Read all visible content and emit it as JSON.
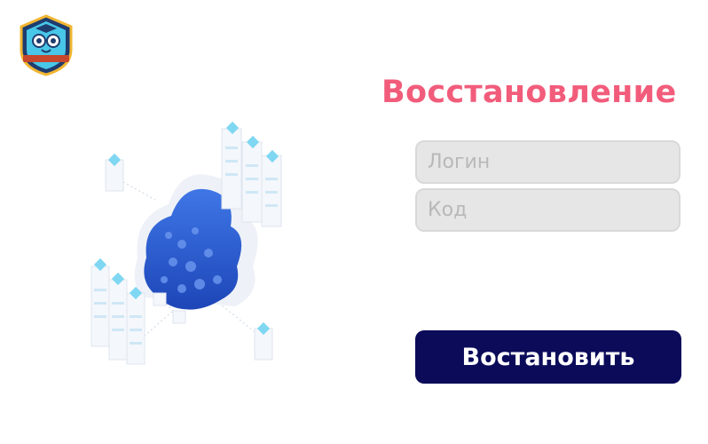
{
  "page": {
    "title": "Восстановление"
  },
  "form": {
    "login_placeholder": "Логин",
    "code_placeholder": "Код",
    "submit_label": "Востановить"
  },
  "icons": {
    "logo": "owl-shield-logo-icon",
    "illustration": "cloud-servers-illustration"
  },
  "colors": {
    "title": "#f25c7b",
    "button_bg": "#0b0b5a",
    "input_bg": "#e6e6e6",
    "cloud_blue": "#2f5fd8"
  }
}
